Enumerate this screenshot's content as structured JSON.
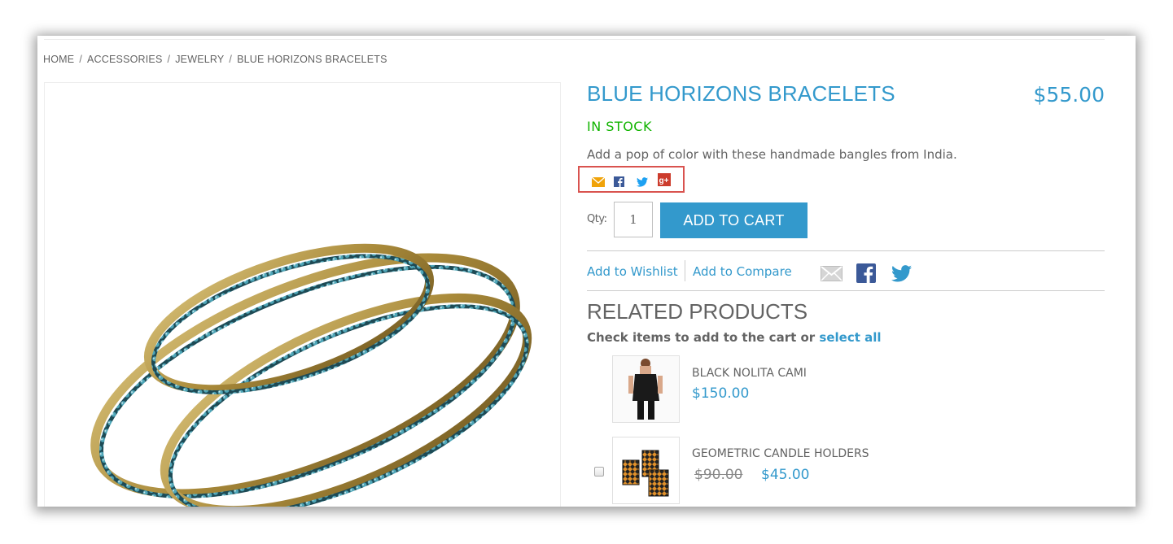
{
  "breadcrumb": {
    "items": [
      "HOME",
      "ACCESSORIES",
      "JEWELRY",
      "BLUE HORIZONS BRACELETS"
    ],
    "separator": "/"
  },
  "product": {
    "title": "BLUE HORIZONS BRACELETS",
    "price": "$55.00",
    "stock": "IN STOCK",
    "description": "Add a pop of color with these handmade bangles from India.",
    "qty_label": "Qty:",
    "qty_value": "1",
    "add_to_cart_label": "ADD TO CART"
  },
  "share_icons": [
    "email-icon",
    "facebook-icon",
    "twitter-icon",
    "google-plus-icon"
  ],
  "actions": {
    "wishlist_label": "Add to Wishlist",
    "compare_label": "Add to Compare",
    "icons": [
      "email-icon",
      "facebook-icon",
      "twitter-icon"
    ]
  },
  "related": {
    "heading": "RELATED PRODUCTS",
    "subtitle_prefix": "Check items to add to the cart or",
    "select_all_label": "select all",
    "items": [
      {
        "name": "BLACK NOLITA CAMI",
        "price": "$150.00"
      },
      {
        "name": "GEOMETRIC CANDLE HOLDERS",
        "old_price": "$90.00",
        "price": "$45.00"
      }
    ]
  },
  "colors": {
    "accent": "#3399cc",
    "in_stock": "#11b400",
    "text": "#636363",
    "highlight_border": "#d9534f"
  }
}
